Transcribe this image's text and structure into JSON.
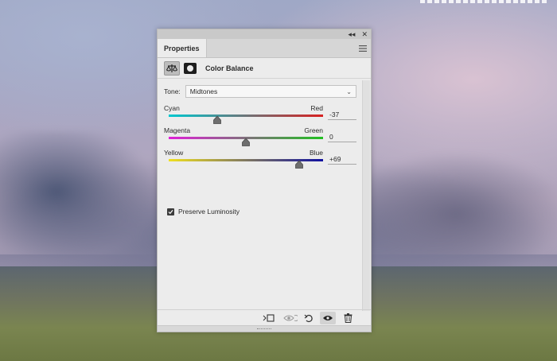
{
  "panel": {
    "tab_label": "Properties",
    "title": "Color Balance",
    "tone": {
      "label": "Tone:",
      "value": "Midtones"
    },
    "sliders": [
      {
        "left": "Cyan",
        "right": "Red",
        "value": "-37",
        "level": -37,
        "gradient": [
          "#00c8d0",
          "#d82020"
        ]
      },
      {
        "left": "Magenta",
        "right": "Green",
        "value": "0",
        "level": 0,
        "gradient": [
          "#e020d8",
          "#20c020"
        ]
      },
      {
        "left": "Yellow",
        "right": "Blue",
        "value": "+69",
        "level": 69,
        "gradient": [
          "#f0e020",
          "#1010a0"
        ]
      }
    ],
    "preserve_luminosity": {
      "label": "Preserve Luminosity",
      "checked": true
    }
  },
  "icons": {
    "collapse": "double-chevron-icon",
    "close": "close-icon",
    "menu": "hamburger-menu-icon",
    "adjustment": "balance-scale-icon",
    "mask": "layer-mask-icon",
    "footer": [
      "clip-to-layer-icon",
      "view-previous-state-icon",
      "reset-icon",
      "visibility-eye-icon",
      "trash-icon"
    ]
  },
  "colors": {
    "panel_bg": "#ececec",
    "panel_chrome": "#c9c9c9"
  }
}
